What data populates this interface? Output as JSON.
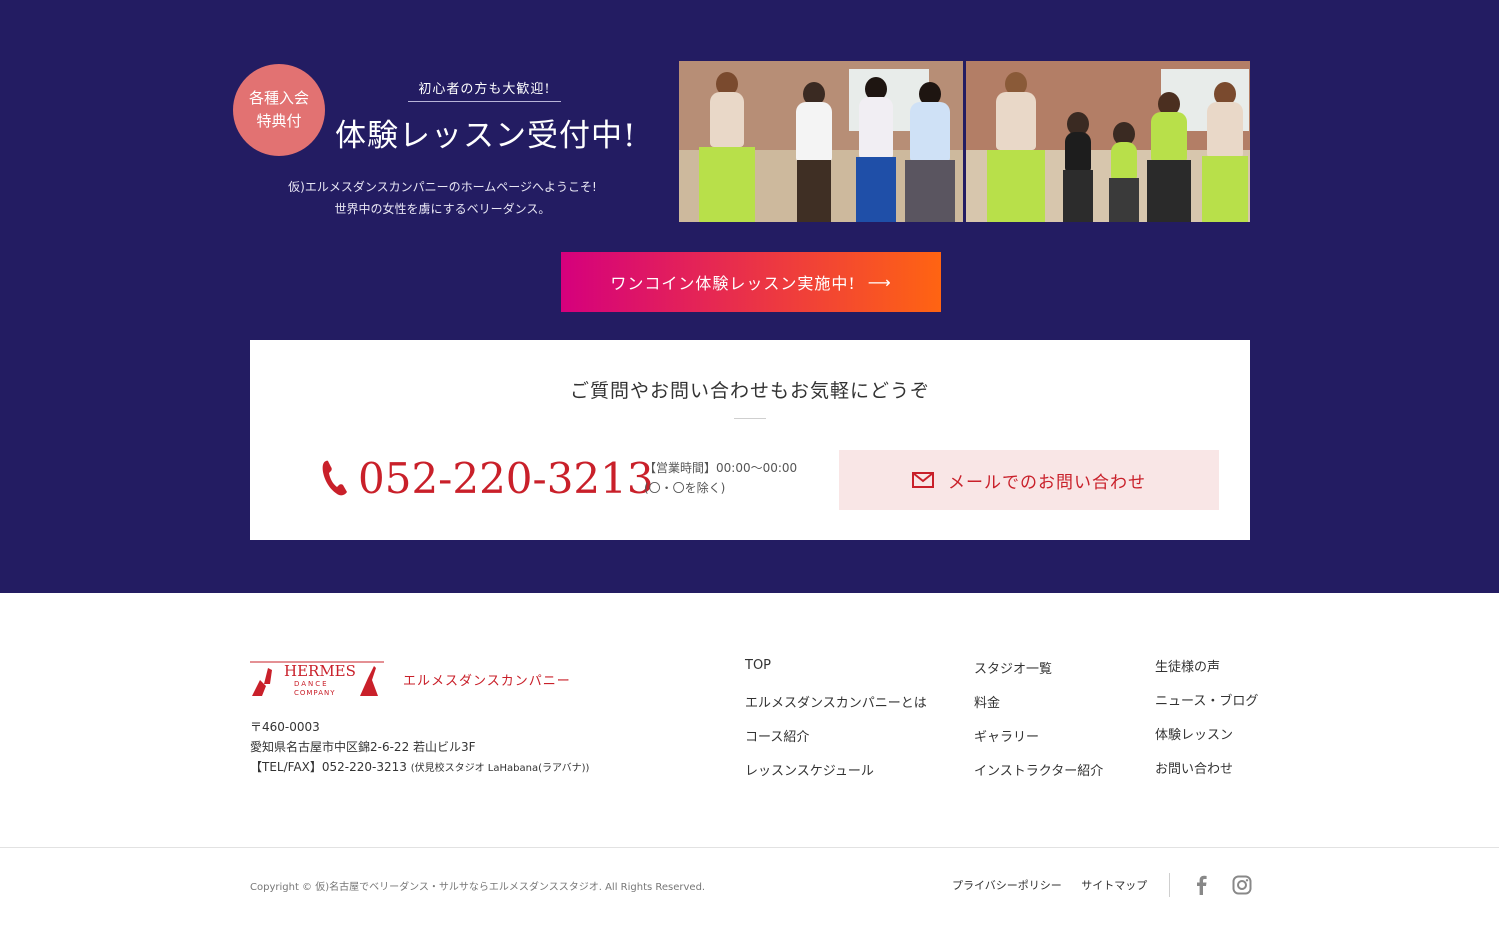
{
  "colors": {
    "hero_bg": "#231c62",
    "badge": "#e27272",
    "accent_red": "#c9202a",
    "cta_from": "#d5007d",
    "cta_to": "#ff6412",
    "mail_bg": "#f9e6e6"
  },
  "hero": {
    "badge_line1": "各種入会",
    "badge_line2": "特典付",
    "welcome": "初心者の方も大歓迎!",
    "headline": "体験レッスン受付中!",
    "intro_line1": "仮)エルメスダンスカンパニーのホームページへようこそ!",
    "intro_line2": "世界中の女性を虜にするベリーダンス。",
    "cta_label": "ワンコイン体験レッスン実施中!",
    "cta_arrow": "⟶"
  },
  "contact": {
    "title": "ご質問やお問い合わせもお気軽にどうぞ",
    "phone": "052-220-3213",
    "hours_line1": "【営業時間】00:00〜00:00",
    "hours_line2": "(〇・〇を除く)",
    "mail_label": "メールでのお問い合わせ",
    "phone_icon": "phone-icon",
    "mail_icon": "envelope-icon"
  },
  "footer": {
    "logo_text": "HERMES",
    "logo_sub1": "DANCE",
    "logo_sub2": "COMPANY",
    "brand_name": "エルメスダンスカンパニー",
    "postal": "〒460-0003",
    "address": "愛知県名古屋市中区錦2-6-22 若山ビル3F",
    "tel": "【TEL/FAX】052-220-3213",
    "tel_note": "(伏見校スタジオ LaHabana(ラアバナ))",
    "nav_col1": [
      "TOP",
      "エルメスダンスカンパニーとは",
      "コース紹介",
      "レッスンスケジュール"
    ],
    "nav_col2": [
      "スタジオ一覧",
      "料金",
      "ギャラリー",
      "インストラクター紹介"
    ],
    "nav_col3": [
      "生徒様の声",
      "ニュース・ブログ",
      "体験レッスン",
      "お問い合わせ"
    ],
    "copyright": "Copyright © 仮)名古屋でベリーダンス・サルサならエルメスダンススタジオ. All Rights Reserved.",
    "privacy": "プライバシーポリシー",
    "sitemap": "サイトマップ",
    "social": [
      "facebook-icon",
      "instagram-icon"
    ]
  }
}
